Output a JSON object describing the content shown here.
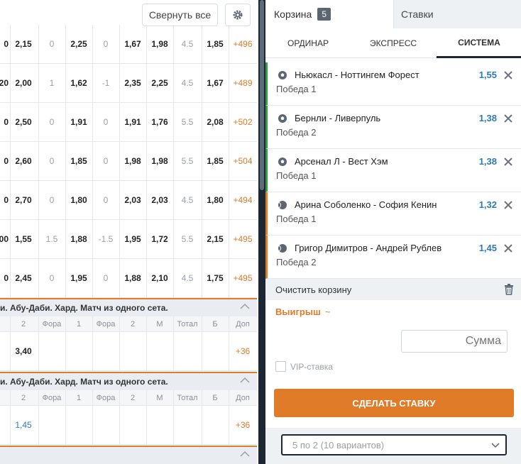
{
  "toolbar": {
    "collapse_label": "Свернуть все"
  },
  "odds_rows": [
    {
      "c": [
        "0",
        "2,15",
        "0",
        "2,25",
        "0",
        "1,67",
        "1,98",
        "4.5",
        "1,85",
        "+496"
      ]
    },
    {
      "c": [
        "20",
        "2,00",
        "1",
        "1,62",
        "-1",
        "2,35",
        "2,25",
        "4.5",
        "1,67",
        "+489"
      ]
    },
    {
      "c": [
        "0",
        "2,50",
        "0",
        "1,91",
        "0",
        "1,91",
        "1,76",
        "5.5",
        "2,08",
        "+502"
      ]
    },
    {
      "c": [
        "0",
        "2,60",
        "0",
        "1,85",
        "0",
        "1,98",
        "1,98",
        "5.5",
        "1,85",
        "+504"
      ]
    },
    {
      "c": [
        "0",
        "2,70",
        "0",
        "1,80",
        "0",
        "2,03",
        "2,03",
        "4.5",
        "1,80",
        "+494"
      ]
    },
    {
      "c": [
        "00",
        "1,55",
        "1.5",
        "1,88",
        "-1.5",
        "1,95",
        "1,72",
        "5.5",
        "2,15",
        "+495"
      ]
    },
    {
      "c": [
        "0",
        "2,45",
        "0",
        "1,95",
        "0",
        "1,88",
        "2,10",
        "4.5",
        "1,75",
        "+495"
      ]
    }
  ],
  "sections": [
    {
      "title": "и. Абу-Даби. Хард. Матч из одного сета.",
      "headers": [
        "2",
        "Фора",
        "1",
        "Фора",
        "2",
        "М",
        "Тотал",
        "Б",
        "Доп"
      ],
      "row": [
        "3,40",
        "+36"
      ]
    },
    {
      "title": "и. Абу-Даби. Хард. Матч из одного сета.",
      "headers": [
        "2",
        "Фора",
        "1",
        "Фора",
        "2",
        "М",
        "Тотал",
        "Б",
        "Доп"
      ],
      "row": [
        "1,45",
        "+36"
      ]
    }
  ],
  "betslip": {
    "tab_basket": "Корзина",
    "basket_count": "5",
    "tab_bets": "Ставки",
    "subtabs": [
      "ОРДИНАР",
      "ЭКСПРЕСС",
      "СИСТЕМА"
    ],
    "items": [
      {
        "sport_icon": "football-icon",
        "event": "Ньюкасл - Ноттингем Форест",
        "outcome": "Победа 1",
        "odd": "1,55"
      },
      {
        "sport_icon": "football-icon",
        "event": "Бернли - Ливерпуль",
        "outcome": "Победа 2",
        "odd": "1,38"
      },
      {
        "sport_icon": "football-icon",
        "event": "Арсенал Л - Вест Хэм",
        "outcome": "Победа 1",
        "odd": "1,38"
      },
      {
        "sport_icon": "tennis-icon",
        "event": "Арина Соболенко - София Кенин",
        "outcome": "Победа 1",
        "odd": "1,32"
      },
      {
        "sport_icon": "tennis-icon",
        "event": "Григор Димитров - Андрей Рублев",
        "outcome": "Победа 2",
        "odd": "1,45"
      }
    ],
    "clear_label": "Очистить корзину",
    "win_label": "Выигрыш",
    "sum_placeholder": "Сумма",
    "vip_label": "VIP-ставка",
    "make_bet_label": "СДЕЛАТЬ СТАВКУ",
    "system_value": "5 по 2 (10 вариантов)"
  },
  "colors": {
    "accent": "#e07b2a",
    "odd_blue": "#2c7ab8",
    "dark": "#1c2733",
    "green_marker": "#2f9e44"
  }
}
